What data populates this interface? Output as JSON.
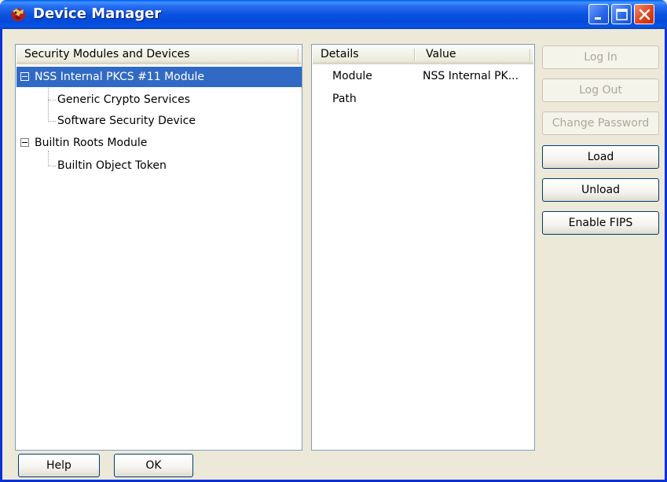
{
  "window": {
    "title": "Device Manager",
    "icon": "firefox-dragon-icon"
  },
  "tree": {
    "header": "Security Modules and Devices",
    "items": [
      {
        "label": "NSS Internal PKCS #11 Module",
        "level": 0,
        "expanded": true,
        "selected": true
      },
      {
        "label": "Generic Crypto Services",
        "level": 1
      },
      {
        "label": "Software Security Device",
        "level": 1
      },
      {
        "label": "Builtin Roots Module",
        "level": 0,
        "expanded": true
      },
      {
        "label": "Builtin Object Token",
        "level": 1
      }
    ]
  },
  "details": {
    "columns": [
      "Details",
      "Value"
    ],
    "rows": [
      {
        "name": "Module",
        "value": "NSS Internal PK..."
      },
      {
        "name": "Path",
        "value": ""
      }
    ]
  },
  "actions": {
    "login": "Log In",
    "logout": "Log Out",
    "change_password": "Change Password",
    "load": "Load",
    "unload": "Unload",
    "enable_fips": "Enable FIPS"
  },
  "footer": {
    "help": "Help",
    "ok": "OK"
  },
  "colors": {
    "titlebar": "#0a53e0",
    "selection": "#316ac5",
    "close_button": "#e0441e"
  }
}
